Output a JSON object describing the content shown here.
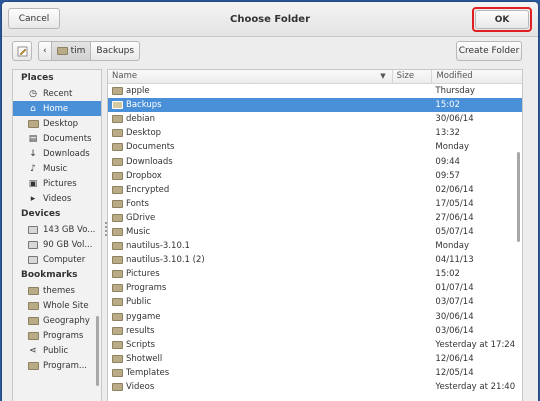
{
  "dialog": {
    "title": "Choose Folder",
    "cancel_label": "Cancel",
    "ok_label": "OK"
  },
  "toolbar": {
    "path": [
      "tim",
      "Backups"
    ],
    "create_folder_label": "Create Folder"
  },
  "sidebar": {
    "sections": [
      {
        "heading": "Places",
        "items": [
          {
            "label": "Recent",
            "icon": "clock-icon"
          },
          {
            "label": "Home",
            "icon": "home-icon",
            "selected": true
          },
          {
            "label": "Desktop",
            "icon": "folder-icon"
          },
          {
            "label": "Documents",
            "icon": "document-icon"
          },
          {
            "label": "Downloads",
            "icon": "download-icon"
          },
          {
            "label": "Music",
            "icon": "music-icon"
          },
          {
            "label": "Pictures",
            "icon": "picture-icon"
          },
          {
            "label": "Videos",
            "icon": "video-icon"
          }
        ]
      },
      {
        "heading": "Devices",
        "items": [
          {
            "label": "143 GB Vo...",
            "icon": "drive-icon"
          },
          {
            "label": "90 GB Vol...",
            "icon": "drive-icon"
          },
          {
            "label": "Computer",
            "icon": "computer-icon"
          }
        ]
      },
      {
        "heading": "Bookmarks",
        "items": [
          {
            "label": "themes",
            "icon": "folder-icon"
          },
          {
            "label": "Whole Site",
            "icon": "folder-icon"
          },
          {
            "label": "Geography",
            "icon": "folder-icon"
          },
          {
            "label": "Programs",
            "icon": "folder-icon"
          },
          {
            "label": "Public",
            "icon": "share-icon"
          },
          {
            "label": "Program...",
            "icon": "folder-icon"
          }
        ]
      }
    ]
  },
  "files": {
    "columns": {
      "name": "Name",
      "size": "Size",
      "modified": "Modified"
    },
    "rows": [
      {
        "name": "apple",
        "modified": "Thursday"
      },
      {
        "name": "Backups",
        "modified": "15:02",
        "selected": true
      },
      {
        "name": "debian",
        "modified": "30/06/14"
      },
      {
        "name": "Desktop",
        "modified": "13:32"
      },
      {
        "name": "Documents",
        "modified": "Monday"
      },
      {
        "name": "Downloads",
        "modified": "09:44"
      },
      {
        "name": "Dropbox",
        "modified": "09:57"
      },
      {
        "name": "Encrypted",
        "modified": "02/06/14"
      },
      {
        "name": "Fonts",
        "modified": "17/05/14"
      },
      {
        "name": "GDrive",
        "modified": "27/06/14"
      },
      {
        "name": "Music",
        "modified": "05/07/14"
      },
      {
        "name": "nautilus-3.10.1",
        "modified": "Monday"
      },
      {
        "name": "nautilus-3.10.1 (2)",
        "modified": "04/11/13"
      },
      {
        "name": "Pictures",
        "modified": "15:02"
      },
      {
        "name": "Programs",
        "modified": "01/07/14"
      },
      {
        "name": "Public",
        "modified": "03/07/14"
      },
      {
        "name": "pygame",
        "modified": "30/06/14"
      },
      {
        "name": "results",
        "modified": "03/06/14"
      },
      {
        "name": "Scripts",
        "modified": "Yesterday at 17:24"
      },
      {
        "name": "Shotwell",
        "modified": "12/06/14"
      },
      {
        "name": "Templates",
        "modified": "12/05/14"
      },
      {
        "name": "Videos",
        "modified": "Yesterday at 21:40"
      }
    ]
  },
  "colors": {
    "selection": "#4a90d9",
    "ok_highlight": "#e02020",
    "desktop": "#2c5a9e"
  }
}
